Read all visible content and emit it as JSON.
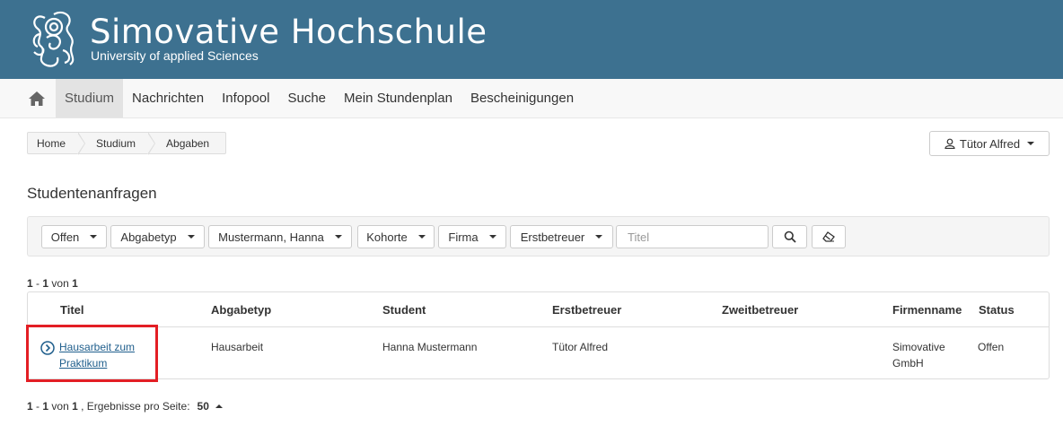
{
  "header": {
    "title": "Simovative Hochschule",
    "subtitle": "University of applied Sciences"
  },
  "nav": {
    "items": [
      {
        "label": "Studium",
        "active": true
      },
      {
        "label": "Nachrichten"
      },
      {
        "label": "Infopool"
      },
      {
        "label": "Suche"
      },
      {
        "label": "Mein Stundenplan"
      },
      {
        "label": "Bescheinigungen"
      }
    ]
  },
  "breadcrumb": [
    "Home",
    "Studium",
    "Abgaben"
  ],
  "user": {
    "name": "Tütor Alfred"
  },
  "page": {
    "title": "Studentenanfragen"
  },
  "filters": {
    "status": "Offen",
    "abgabetyp": "Abgabetyp",
    "student": "Mustermann, Hanna",
    "kohorte": "Kohorte",
    "firma": "Firma",
    "erstbetreuer": "Erstbetreuer",
    "title_placeholder": "Titel"
  },
  "results": {
    "from": "1",
    "to": "1",
    "of_word": "von",
    "total": "1",
    "per_page_label": ", Ergebnisse pro Seite:",
    "per_page": "50"
  },
  "table": {
    "headers": [
      "Titel",
      "Abgabetyp",
      "Student",
      "Erstbetreuer",
      "Zweitbetreuer",
      "Firmenname",
      "Status"
    ],
    "rows": [
      {
        "titel": "Hausarbeit zum Praktikum",
        "abgabetyp": "Hausarbeit",
        "student": "Hanna Mustermann",
        "erstbetreuer": "Tütor Alfred",
        "zweitbetreuer": "",
        "firmenname": "Simovative GmbH",
        "status": "Offen"
      }
    ]
  },
  "colors": {
    "header_bg": "#3d7190",
    "link": "#1f5e8c",
    "highlight": "#e31e24"
  }
}
